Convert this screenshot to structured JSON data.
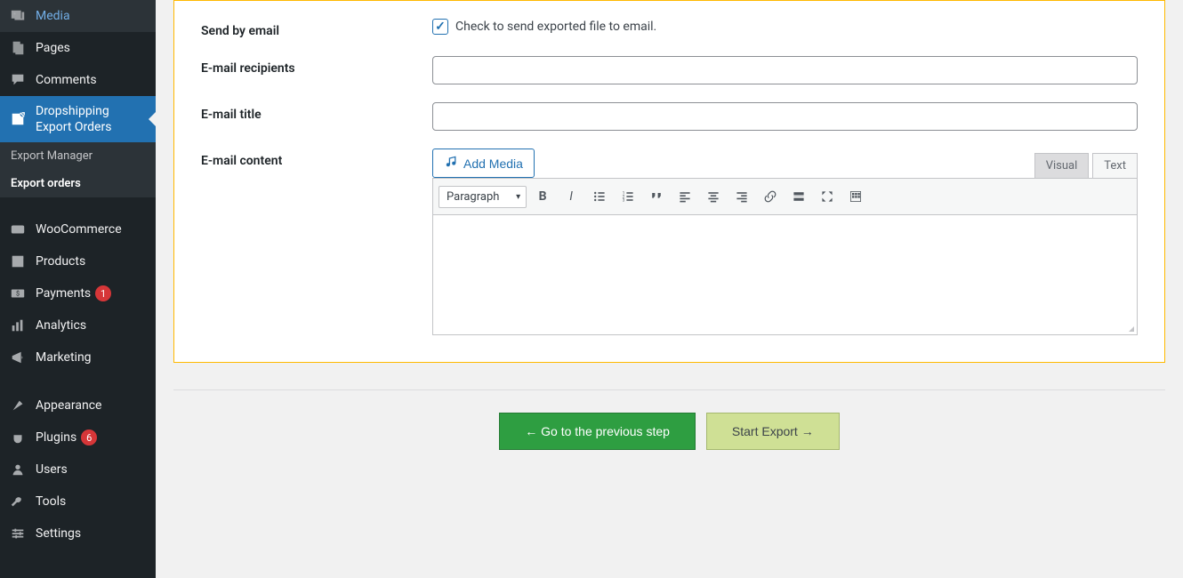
{
  "sidebar": {
    "items": [
      {
        "label": "Media",
        "icon": "media"
      },
      {
        "label": "Pages",
        "icon": "pages"
      },
      {
        "label": "Comments",
        "icon": "comments"
      },
      {
        "label": "Dropshipping Export Orders",
        "icon": "export",
        "active": true
      },
      {
        "label": "WooCommerce",
        "icon": "woo"
      },
      {
        "label": "Products",
        "icon": "products"
      },
      {
        "label": "Payments",
        "icon": "payments",
        "badge": "1"
      },
      {
        "label": "Analytics",
        "icon": "analytics"
      },
      {
        "label": "Marketing",
        "icon": "marketing"
      },
      {
        "label": "Appearance",
        "icon": "appearance"
      },
      {
        "label": "Plugins",
        "icon": "plugins",
        "badge": "6"
      },
      {
        "label": "Users",
        "icon": "users"
      },
      {
        "label": "Tools",
        "icon": "tools"
      },
      {
        "label": "Settings",
        "icon": "settings"
      }
    ],
    "submenu": [
      {
        "label": "Export Manager"
      },
      {
        "label": "Export orders",
        "current": true
      }
    ]
  },
  "form": {
    "send_by_email_label": "Send by email",
    "send_by_email_checked": true,
    "send_by_email_desc": "Check to send exported file to email.",
    "recipients_label": "E-mail recipients",
    "recipients_value": "",
    "title_label": "E-mail title",
    "title_value": "",
    "content_label": "E-mail content",
    "add_media_label": "Add Media",
    "editor": {
      "tab_visual": "Visual",
      "tab_text": "Text",
      "format_selected": "Paragraph"
    }
  },
  "actions": {
    "prev_label": "← Go to the previous step",
    "export_label": "Start Export →"
  },
  "colors": {
    "accent": "#2271b1",
    "sidebar_bg": "#1d2327",
    "badge": "#d63638",
    "btn_green": "#2e9e41",
    "btn_olive": "#cfe095"
  }
}
